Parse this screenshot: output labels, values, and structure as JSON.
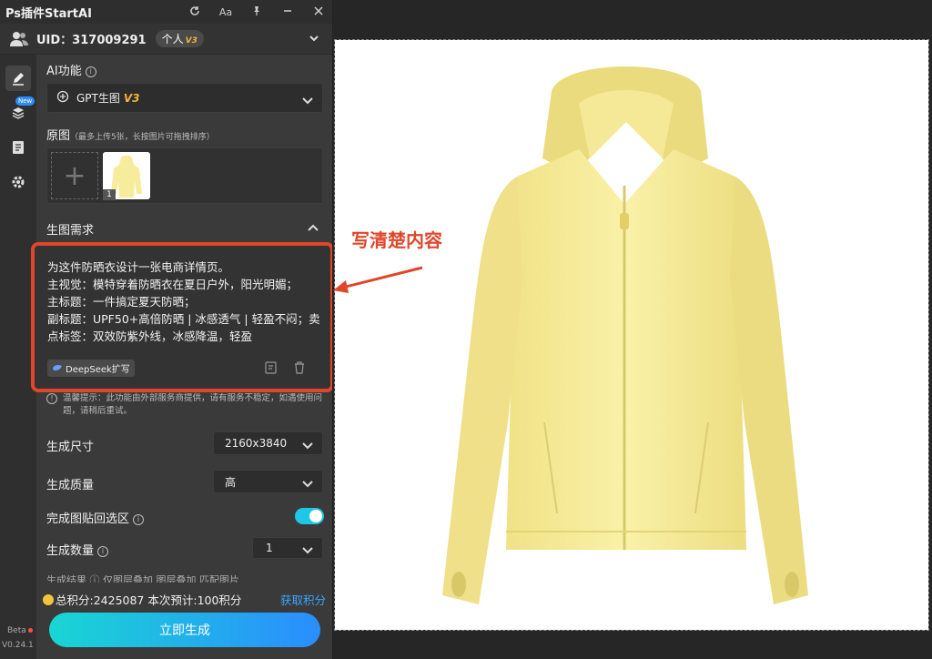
{
  "app": {
    "title": "Ps插件StartAI",
    "uid_text": "UID：317009291",
    "tier": "个人",
    "tier_version": "V3",
    "new_badge": "New",
    "beta": "Beta",
    "version": "V0.24.1"
  },
  "ai_function": {
    "label": "AI功能",
    "selected": "GPT生图",
    "selected_version": "V3"
  },
  "original_image": {
    "label": "原图",
    "hint": "（最多上传5张，长按图片可拖拽排序）",
    "thumb_index": "1"
  },
  "requirement": {
    "label": "生图需求",
    "text": "为这件防晒衣设计一张电商详情页。\n主视觉：模特穿着防晒衣在夏日户外，阳光明媚；\n主标题：一件搞定夏天防晒；\n副标题：UPF50+高倍防晒 | 冰感透气 | 轻盈不闷；卖点标签：双效防紫外线，冰感降温，轻盈",
    "deepseek_button": "DeepSeek扩写",
    "notice": "温馨提示：此功能由外部服务商提供，请有服务不稳定，如遇使用问题，请稍后重试。"
  },
  "settings": {
    "size_label": "生成尺寸",
    "size_value": "2160x3840",
    "quality_label": "生成质量",
    "quality_value": "高",
    "paste_label": "完成图贴回选区",
    "paste_on": true,
    "count_label": "生成数量",
    "count_value": "1",
    "partial_row": "生成结果  ⓘ 仅图层叠加   图层叠加   匹配图片"
  },
  "footer": {
    "points_text": "总积分:2425087  本次预计:100积分",
    "get_points": "获取积分",
    "generate_button": "立即生成"
  },
  "annotation": {
    "text": "写清楚内容",
    "color": "#e0462a"
  },
  "colors": {
    "accent": "#1ec7e6",
    "link": "#3aa6ff",
    "jacket": "#f7ec9c"
  }
}
